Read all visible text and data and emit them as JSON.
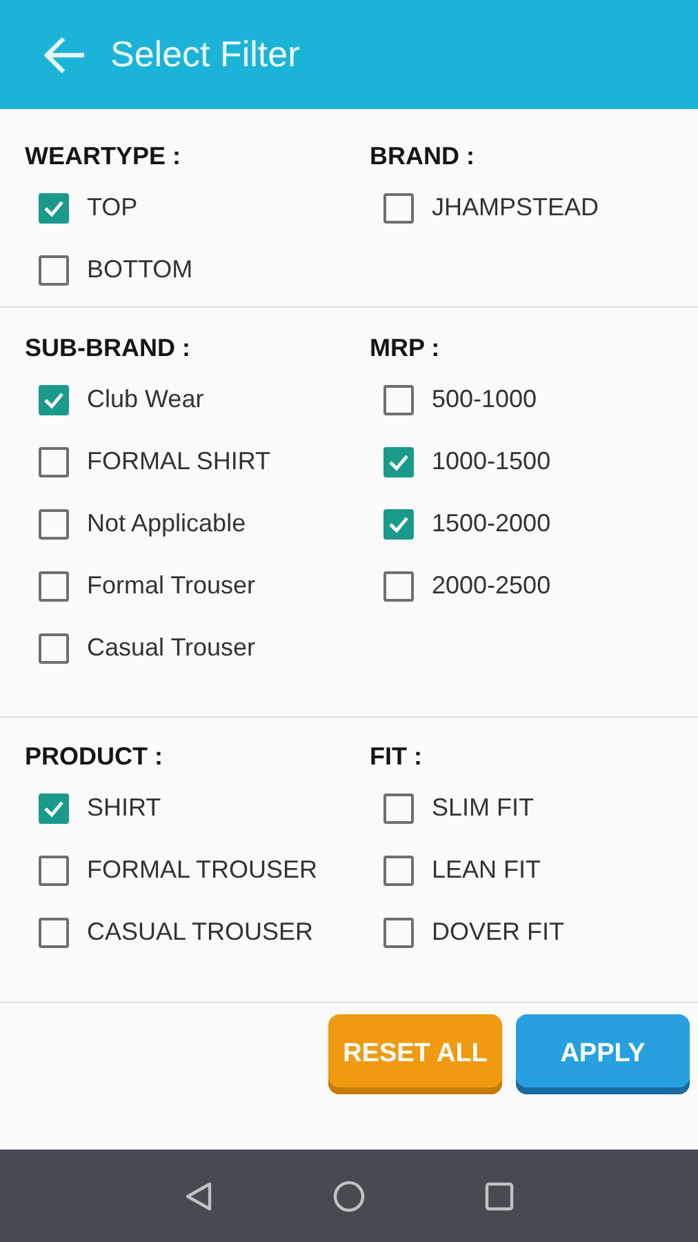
{
  "app_bar": {
    "title": "Select Filter"
  },
  "sections": [
    {
      "groups": [
        {
          "heading": "WEARTYPE :",
          "options": [
            {
              "label": "TOP",
              "checked": true
            },
            {
              "label": "BOTTOM",
              "checked": false
            }
          ]
        },
        {
          "heading": "BRAND :",
          "options": [
            {
              "label": "JHAMPSTEAD",
              "checked": false
            }
          ]
        }
      ]
    },
    {
      "groups": [
        {
          "heading": "SUB-BRAND :",
          "options": [
            {
              "label": "Club Wear",
              "checked": true
            },
            {
              "label": "FORMAL SHIRT",
              "checked": false
            },
            {
              "label": "Not Applicable",
              "checked": false
            },
            {
              "label": "Formal Trouser",
              "checked": false
            },
            {
              "label": "Casual Trouser",
              "checked": false
            }
          ]
        },
        {
          "heading": "MRP :",
          "options": [
            {
              "label": "500-1000",
              "checked": false
            },
            {
              "label": "1000-1500",
              "checked": true
            },
            {
              "label": "1500-2000",
              "checked": true
            },
            {
              "label": "2000-2500",
              "checked": false
            }
          ]
        }
      ]
    },
    {
      "groups": [
        {
          "heading": "PRODUCT :",
          "options": [
            {
              "label": "SHIRT",
              "checked": true
            },
            {
              "label": "FORMAL TROUSER",
              "checked": false
            },
            {
              "label": "CASUAL TROUSER",
              "checked": false
            }
          ]
        },
        {
          "heading": "FIT :",
          "options": [
            {
              "label": "SLIM FIT",
              "checked": false
            },
            {
              "label": "LEAN FIT",
              "checked": false
            },
            {
              "label": "DOVER FIT",
              "checked": false
            }
          ]
        }
      ]
    }
  ],
  "buttons": [
    {
      "label": "RESET ALL",
      "kind": "reset"
    },
    {
      "label": "APPLY",
      "kind": "apply"
    }
  ]
}
